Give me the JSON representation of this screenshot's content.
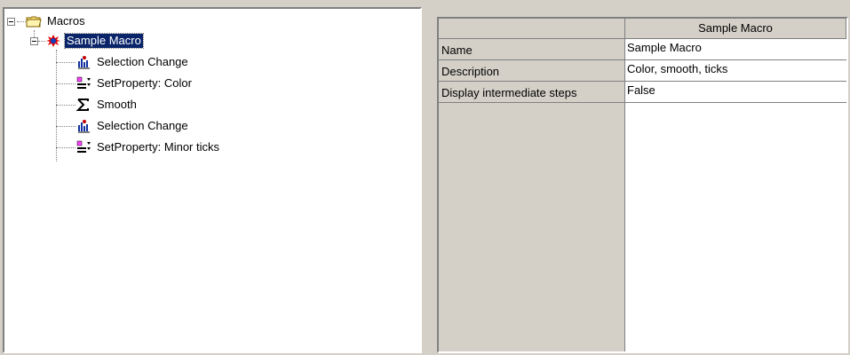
{
  "tree": {
    "root": {
      "label": "Macros",
      "icon": "folder-icon"
    },
    "macro": {
      "label": "Sample Macro",
      "icon": "macro-icon"
    },
    "steps": [
      {
        "label": "Selection Change",
        "icon": "selection-change-icon"
      },
      {
        "label": "SetProperty: Color",
        "icon": "set-property-icon"
      },
      {
        "label": "Smooth",
        "icon": "sigma-icon"
      },
      {
        "label": "Selection Change",
        "icon": "selection-change-icon"
      },
      {
        "label": "SetProperty: Minor ticks",
        "icon": "set-property-icon"
      }
    ]
  },
  "grid": {
    "header": "Sample Macro",
    "rows": [
      {
        "name": "Name",
        "value": "Sample Macro"
      },
      {
        "name": "Description",
        "value": "Color, smooth, ticks"
      },
      {
        "name": "Display intermediate steps",
        "value": "False"
      }
    ]
  },
  "colors": {
    "selection": "#0a246a",
    "face": "#d4d0c8"
  }
}
